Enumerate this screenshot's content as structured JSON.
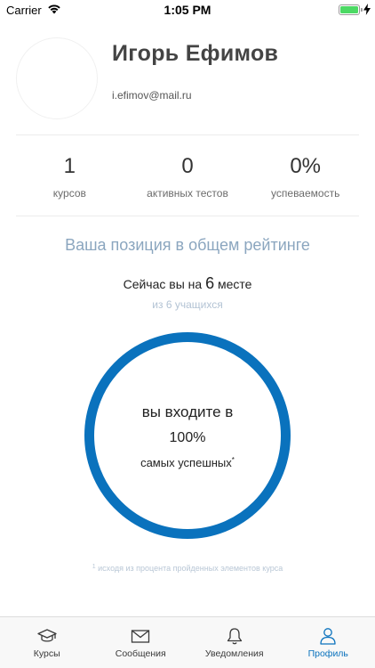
{
  "status_bar": {
    "carrier": "Carrier",
    "time": "1:05 PM",
    "battery_color": "#4cd964"
  },
  "profile": {
    "name": "Игорь Ефимов",
    "email": "i.efimov@mail.ru"
  },
  "stats": [
    {
      "value": "1",
      "label": "курсов"
    },
    {
      "value": "0",
      "label": "активных тестов"
    },
    {
      "value": "0%",
      "label": "успеваемость"
    }
  ],
  "rating": {
    "title": "Ваша позиция в общем рейтинге",
    "place_prefix": "Сейчас вы на",
    "place_number": "6",
    "place_suffix": "месте",
    "of_text": "из 6 учащихся",
    "ring_line1": "вы входите в",
    "ring_percent": "100%",
    "ring_line3": "самых успешных",
    "ring_mark": "*",
    "footnote_mark": "1",
    "footnote": "исходя из процента пройденных элементов курса",
    "ring_color": "#0a72bd"
  },
  "tabs": [
    {
      "label": "Курсы",
      "icon": "graduation-cap-icon",
      "active": false
    },
    {
      "label": "Сообщения",
      "icon": "envelope-icon",
      "active": false
    },
    {
      "label": "Уведомления",
      "icon": "bell-icon",
      "active": false
    },
    {
      "label": "Профиль",
      "icon": "user-icon",
      "active": true
    }
  ],
  "colors": {
    "accent": "#0a72bd",
    "muted_blue": "#8ba6bf"
  }
}
